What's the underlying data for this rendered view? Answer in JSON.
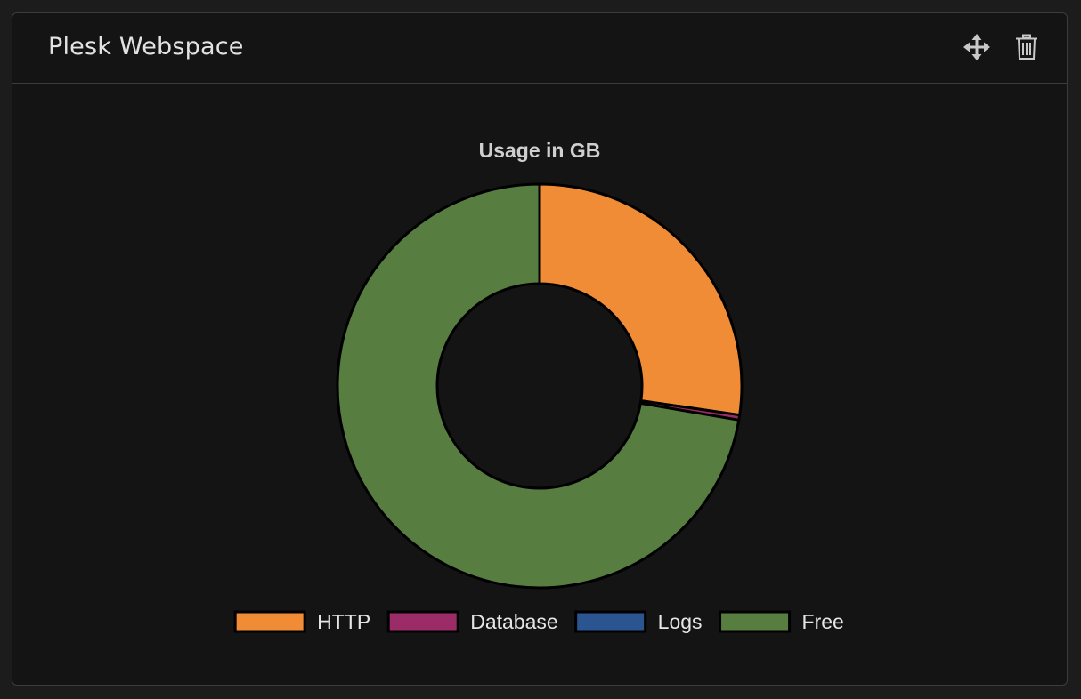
{
  "panel": {
    "title": "Plesk Webspace",
    "move_icon": "move-arrows-icon",
    "delete_icon": "trash-icon"
  },
  "chart_data": {
    "type": "pie",
    "style": "doughnut",
    "title": "Usage in GB",
    "unit": "GB",
    "categories": [
      "HTTP",
      "Database",
      "Logs",
      "Free"
    ],
    "values": [
      27.3,
      0.4,
      0.0,
      72.3
    ],
    "colors": [
      "#f08c35",
      "#9b2c67",
      "#2b5590",
      "#577d41"
    ],
    "legend_position": "bottom"
  },
  "colors": {
    "background": "#141414",
    "border": "#3c3c3c",
    "text": "#e2e2e2"
  }
}
